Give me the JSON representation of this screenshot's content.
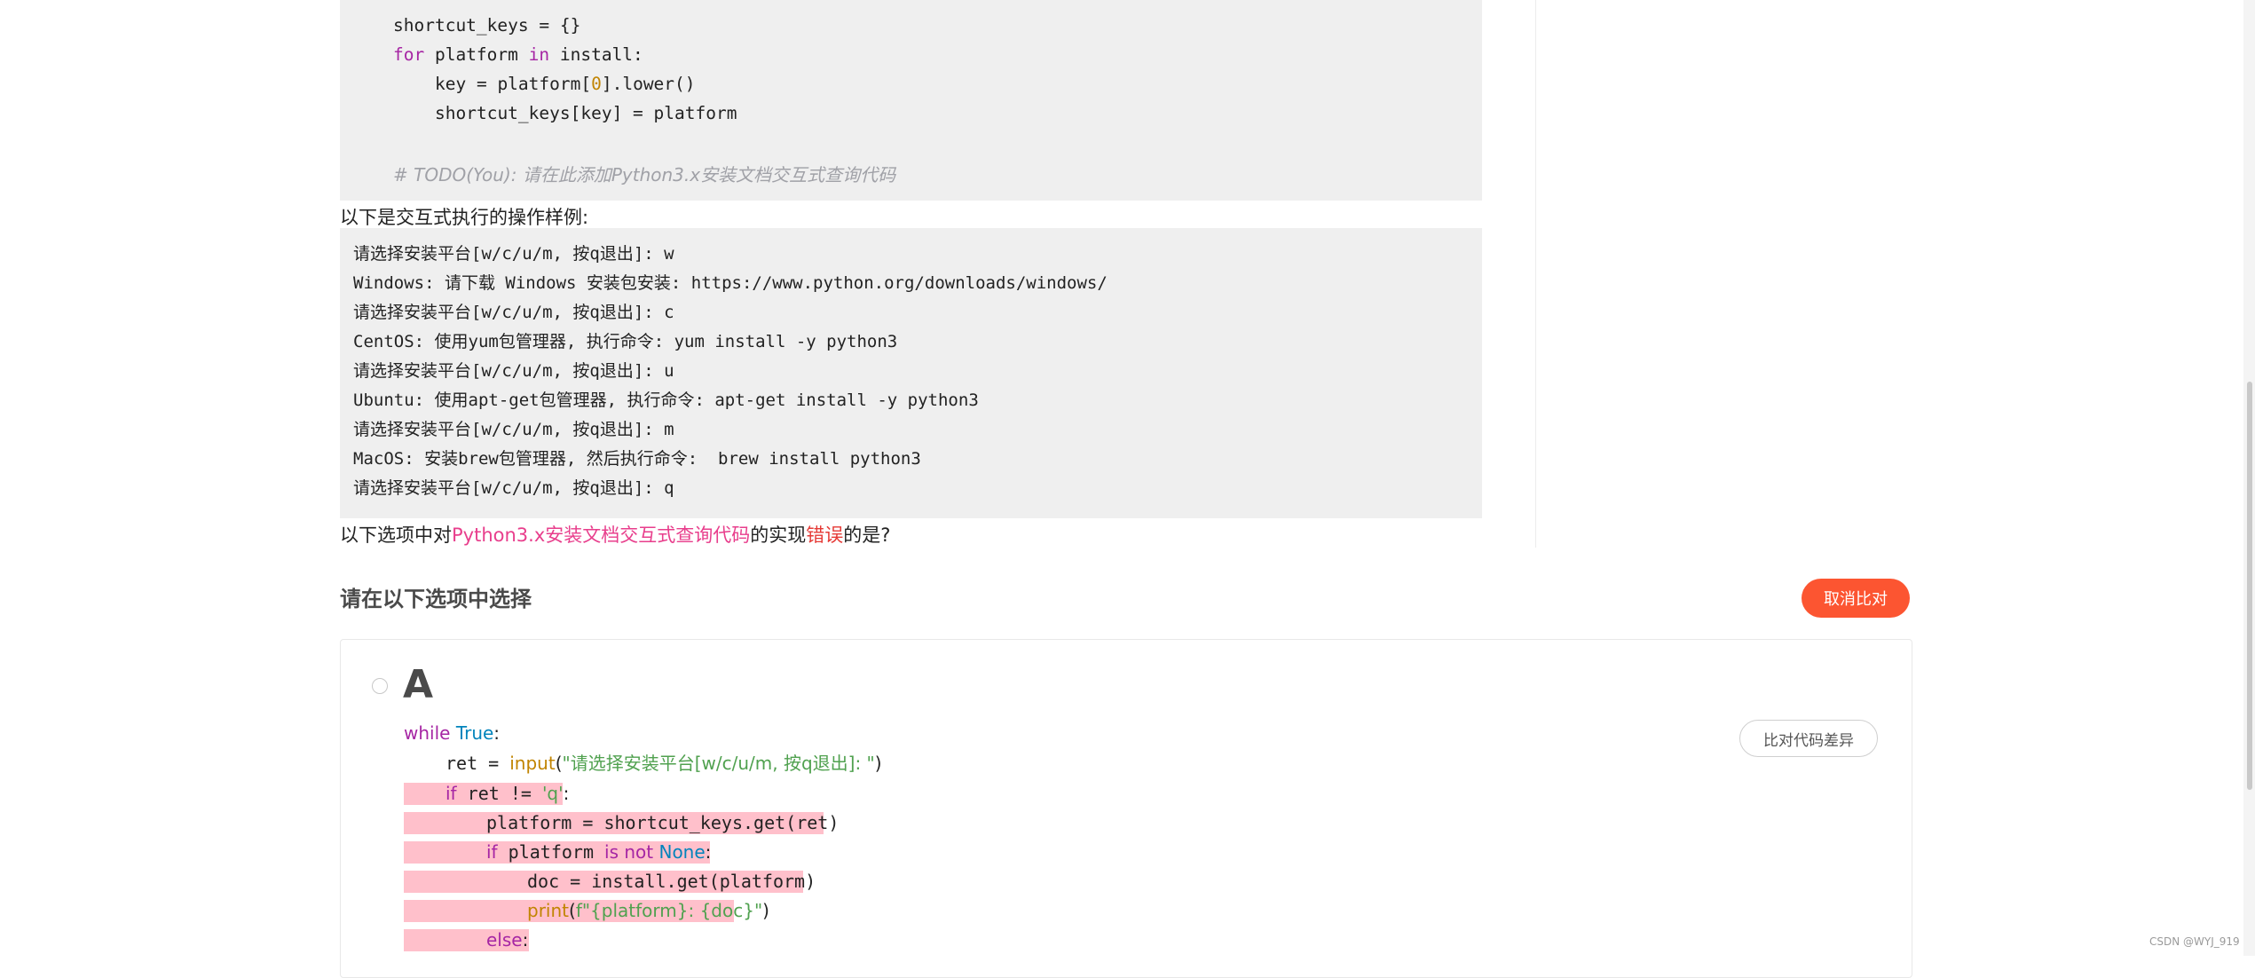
{
  "code_top": {
    "line1": "shortcut_keys = {}",
    "line2_kw": "for",
    "line2_a": " platform ",
    "line2_kw2": "in",
    "line2_b": " install:",
    "line3_a": "key = platform[",
    "line3_num": "0",
    "line3_b": "].lower()",
    "line4": "shortcut_keys[key] = platform",
    "comment": "# TODO(You): 请在此添加Python3.x安装文档交互式查询代码"
  },
  "intro_text": "以下是交互式执行的操作样例:",
  "example_lines": [
    "请选择安装平台[w/c/u/m, 按q退出]: w",
    "Windows: 请下载 Windows 安装包安装: https://www.python.org/downloads/windows/",
    "请选择安装平台[w/c/u/m, 按q退出]: c",
    "CentOS: 使用yum包管理器, 执行命令: yum install -y python3",
    "请选择安装平台[w/c/u/m, 按q退出]: u",
    "Ubuntu: 使用apt-get包管理器, 执行命令: apt-get install -y python3",
    "请选择安装平台[w/c/u/m, 按q退出]: m",
    "MacOS: 安装brew包管理器, 然后执行命令:  brew install python3",
    "请选择安装平台[w/c/u/m, 按q退出]: q"
  ],
  "question": {
    "prefix": "以下选项中对",
    "topic": "Python3.x安装文档交互式查询代码",
    "middle": "的实现",
    "emphasis": "错误",
    "suffix": "的是?"
  },
  "section_title": "请在以下选项中选择",
  "cancel_compare_label": "取消比对",
  "option": {
    "letter": "A",
    "diff_button_label": "比对代码差异",
    "code": {
      "l1_kw": "while",
      "l1_true": "True",
      "l1_colon": ":",
      "l2_a": "ret = ",
      "l2_fn": "input",
      "l2_paren": "(",
      "l2_str": "\"请选择安装平台[w/c/u/m, 按q退出]: \"",
      "l2_close": ")",
      "l3_kw": "if",
      "l3_a": " ret != ",
      "l3_str": "'q'",
      "l3_colon": ":",
      "l4": "platform = shortcut_keys.get(ret)",
      "l5_kw": "if",
      "l5_a": " platform ",
      "l5_kw2": "is not",
      "l5_none": "None",
      "l5_colon": ":",
      "l6": "doc = install.get(platform)",
      "l7_fn": "print",
      "l7_paren": "(",
      "l7_str": "f\"{platform}: {doc}\"",
      "l7_close": ")",
      "l8_kw": "else",
      "l8_colon": ":"
    }
  },
  "watermark": "CSDN @WYJ_919"
}
